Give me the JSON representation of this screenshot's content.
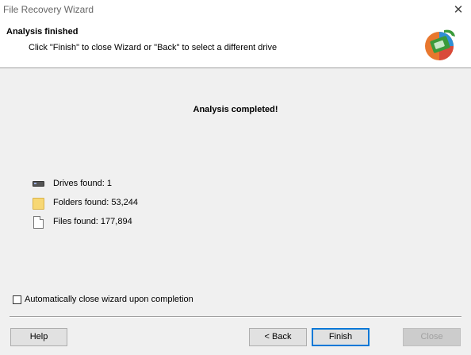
{
  "window": {
    "title": "File Recovery Wizard",
    "close_glyph": "✕"
  },
  "header": {
    "title": "Analysis finished",
    "subtitle": "Click \"Finish\" to close Wizard or \"Back\" to select a different drive",
    "logo_icon": "recovery-logo-icon"
  },
  "main": {
    "message": "Analysis completed!",
    "stats": [
      {
        "icon": "drive-icon",
        "label": "Drives found: 1"
      },
      {
        "icon": "folder-icon",
        "label": "Folders found: 53,244"
      },
      {
        "icon": "file-icon",
        "label": "Files found: 177,894"
      }
    ]
  },
  "options": {
    "auto_close_label": "Automatically close wizard upon completion",
    "auto_close_checked": false
  },
  "buttons": {
    "help": "Help",
    "back": "< Back",
    "finish": "Finish",
    "close": "Close"
  }
}
